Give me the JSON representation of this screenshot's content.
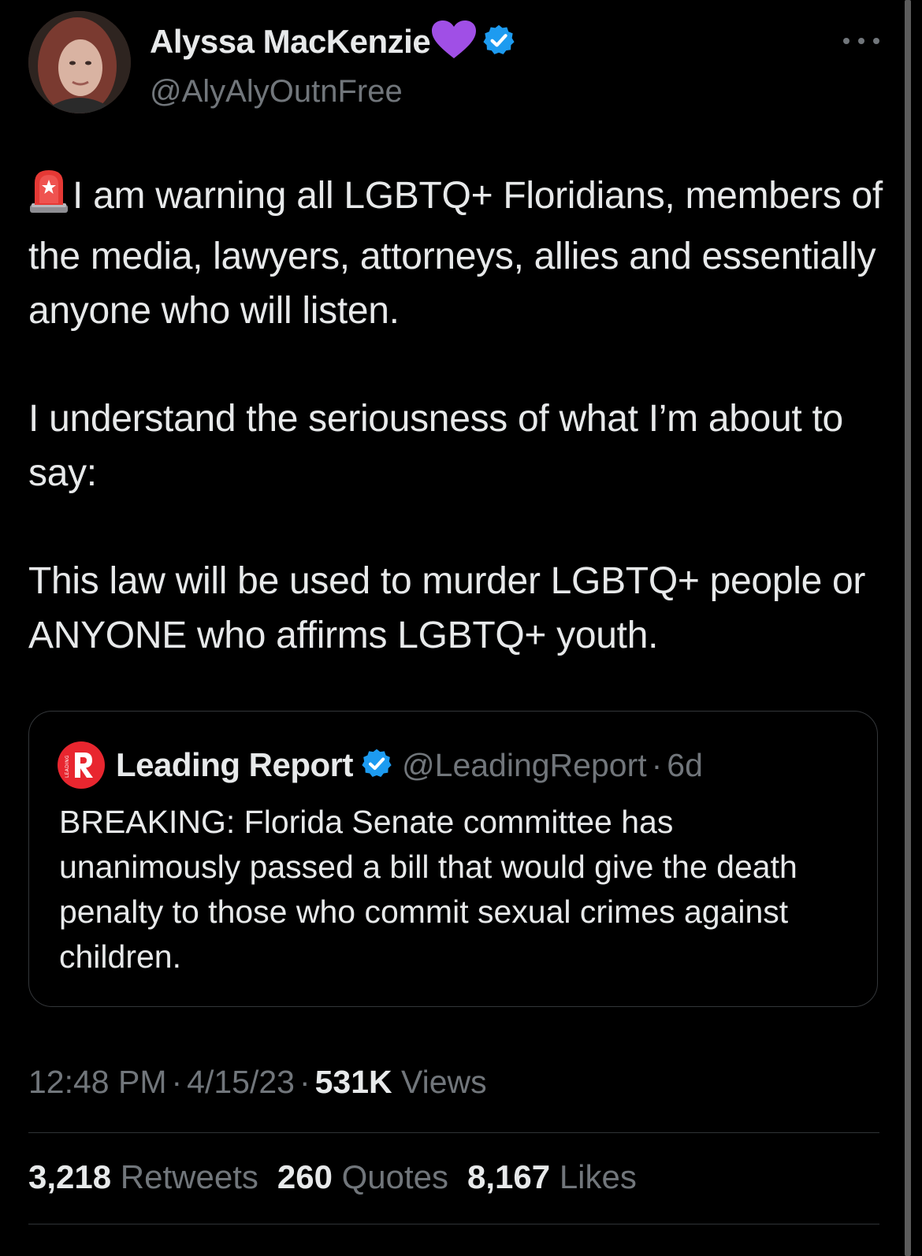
{
  "tweet": {
    "author": {
      "name": "Alyssa MacKenzie",
      "name_emoji": "purple-heart-icon",
      "verified": true,
      "handle": "@AlyAlyOutnFree"
    },
    "body": {
      "emoji": "police-light-icon",
      "paragraph_1": "I am warning all LGBTQ+ Floridians, members of the media, lawyers, attorneys, allies and essentially anyone who will listen.",
      "paragraph_2": "I understand the seriousness of what I’m about to say:",
      "paragraph_3": "This law will be used to murder LGBTQ+ people or ANYONE who affirms LGBTQ+ youth."
    },
    "quote": {
      "author_name": "Leading Report",
      "verified": true,
      "handle": "@LeadingReport",
      "separator": "·",
      "time": "6d",
      "text": "BREAKING: Florida Senate committee has unanimously passed a bill that would give the death penalty to those who commit sexual crimes against children."
    },
    "meta": {
      "time": "12:48 PM",
      "separator": "·",
      "date": "4/15/23",
      "views_count": "531K",
      "views_label": "Views"
    },
    "stats": {
      "retweets_count": "3,218",
      "retweets_label": "Retweets",
      "quotes_count": "260",
      "quotes_label": "Quotes",
      "likes_count": "8,167",
      "likes_label": "Likes"
    }
  },
  "colors": {
    "background": "#000000",
    "text_primary": "#e7e9ea",
    "text_secondary": "#71767b",
    "verified_blue": "#1d9bf0",
    "heart_purple": "#a04fe6",
    "border": "#333639",
    "leading_report_red": "#e8262f"
  }
}
